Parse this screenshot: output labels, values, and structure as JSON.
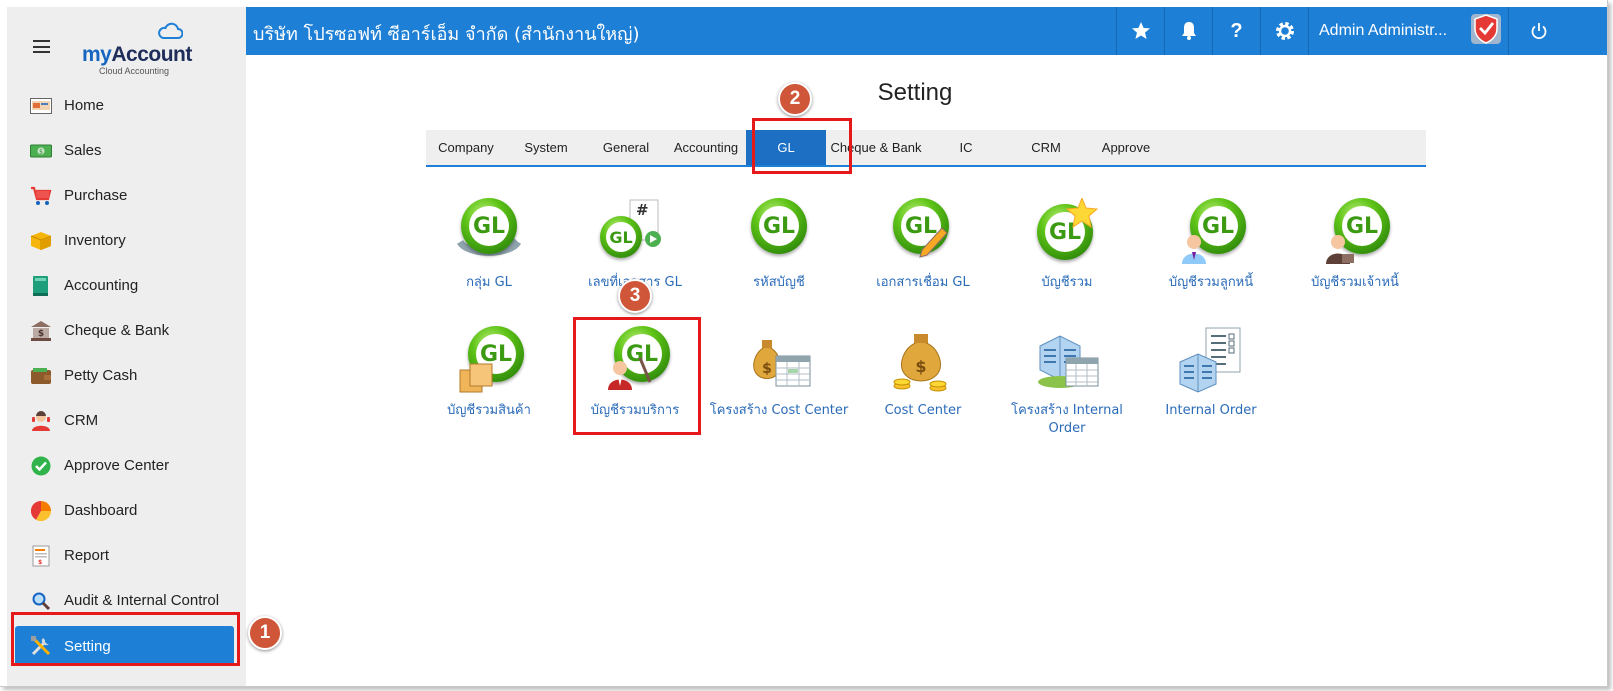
{
  "app": {
    "brand_my": "my",
    "brand_account": "Account",
    "brand_sub": "Cloud Accounting",
    "company_name": "บริษัท โปรซอฟท์ ซีอาร์เอ็ม จำกัด (สำนักงานใหญ่)"
  },
  "topbar": {
    "user_name": "Admin Administr..."
  },
  "sidebar": {
    "items": [
      {
        "label": "Home",
        "icon": "home-icon"
      },
      {
        "label": "Sales",
        "icon": "sales-icon"
      },
      {
        "label": "Purchase",
        "icon": "cart-icon"
      },
      {
        "label": "Inventory",
        "icon": "box-icon"
      },
      {
        "label": "Accounting",
        "icon": "book-icon"
      },
      {
        "label": "Cheque & Bank",
        "icon": "bank-icon"
      },
      {
        "label": "Petty Cash",
        "icon": "wallet-icon"
      },
      {
        "label": "CRM",
        "icon": "crm-icon"
      },
      {
        "label": "Approve Center",
        "icon": "check-icon"
      },
      {
        "label": "Dashboard",
        "icon": "pie-chart-icon"
      },
      {
        "label": "Report",
        "icon": "report-icon"
      },
      {
        "label": "Audit & Internal Control",
        "icon": "magnifier-icon"
      },
      {
        "label": "Setting",
        "icon": "tools-icon",
        "active": true
      }
    ]
  },
  "main": {
    "title": "Setting",
    "tabs": [
      "Company",
      "System",
      "General",
      "Accounting",
      "GL",
      "Cheque & Bank",
      "IC",
      "CRM",
      "Approve"
    ],
    "active_tab": "GL",
    "grid_row1": [
      "กลุ่ม GL",
      "เลขที่เอกสาร GL",
      "รหัสบัญชี",
      "เอกสารเชื่อม GL",
      "บัญชีรวม",
      "บัญชีรวมลูกหนี้",
      "บัญชีรวมเจ้าหนี้"
    ],
    "grid_row2": [
      "บัญชีรวมสินค้า",
      "บัญชีรวมบริการ",
      "โครงสร้าง Cost Center",
      "Cost Center",
      "โครงสร้าง Internal Order",
      "Internal Order"
    ]
  },
  "annotations": {
    "step1": "1",
    "step2": "2",
    "step3": "3",
    "highlight_color": "#e51919",
    "badge_color": "#cf5638"
  },
  "colors": {
    "primary": "#1d7fd6",
    "link": "#2a6bb8"
  }
}
